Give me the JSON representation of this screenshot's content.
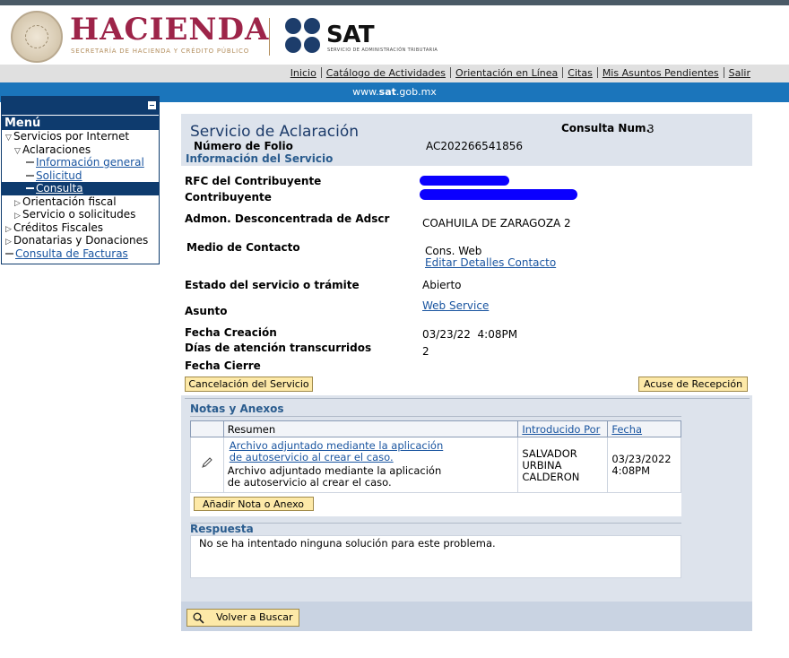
{
  "header": {
    "brand": "HACIENDA",
    "brand_sub": "SECRETARÍA DE HACIENDA Y CRÉDITO PÚBLICO",
    "sat": "SAT",
    "sat_sub": "SERVICIO DE ADMINISTRACIÓN TRIBUTARIA"
  },
  "nav": {
    "links": [
      "Inicio",
      "Catálogo de Actividades",
      "Orientación en Línea",
      "Citas",
      "Mis Asuntos Pendientes",
      "Salir"
    ]
  },
  "band": {
    "url_pre": "www.",
    "url_bold": "sat",
    "url_post": ".gob.mx"
  },
  "menu": {
    "title": "Menú",
    "items": [
      "Servicios por Internet",
      "Aclaraciones",
      "Información general",
      "Solicitud",
      "Consulta",
      "Orientación fiscal",
      "Servicio o solicitudes",
      "Créditos Fiscales",
      "Donatarias y Donaciones",
      "Consulta de Facturas"
    ]
  },
  "main": {
    "title": "Servicio de Aclaración",
    "consulta_label": "Consulta Num.",
    "consulta_value": "3",
    "folio_label": "Número de Folio",
    "folio_value": "AC202266541856",
    "info_section": "Información del Servicio",
    "rfc_label": "RFC del Contribuyente",
    "contribuyente_label": "Contribuyente",
    "admon_label": "Admon. Desconcentrada de Adscr",
    "admon_value": "COAHUILA DE ZARAGOZA 2",
    "medio_label": "Medio de Contacto",
    "medio_value": "Cons. Web",
    "editar_link": "Editar Detalles Contacto",
    "estado_label": "Estado del servicio o trámite",
    "estado_value": "Abierto",
    "asunto_label": "Asunto",
    "asunto_value": "Web Service",
    "fecha_creacion_label": "Fecha Creación",
    "fecha_creacion_value": "03/23/22  4:08PM",
    "dias_label": "Días de atención transcurridos",
    "dias_value": "2",
    "fecha_cierre_label": "Fecha Cierre",
    "cancel_button": "Cancelación del Servicio",
    "acuse_button": "Acuse de Recepción"
  },
  "notes": {
    "section": "Notas y Anexos",
    "columns": [
      "Resumen",
      "Introducido Por",
      "Fecha"
    ],
    "rows": [
      {
        "link": "Archivo adjuntado mediante la aplicación de autoservicio al crear el caso.",
        "text": "Archivo adjuntado mediante la aplicación de autoservicio al crear el caso.",
        "author": "SALVADOR URBINA CALDERON",
        "date": "03/23/2022 4:08PM"
      }
    ],
    "add_button": "Añadir Nota o Anexo"
  },
  "respuesta": {
    "section": "Respuesta",
    "text": "No se ha intentado ninguna solución para este problema."
  },
  "footer": {
    "back_button": "Volver a Buscar"
  },
  "colors": {
    "brand": "#9d2449",
    "navy": "#0e3b6e",
    "band": "#1b75bb",
    "button": "#fde9a8"
  }
}
